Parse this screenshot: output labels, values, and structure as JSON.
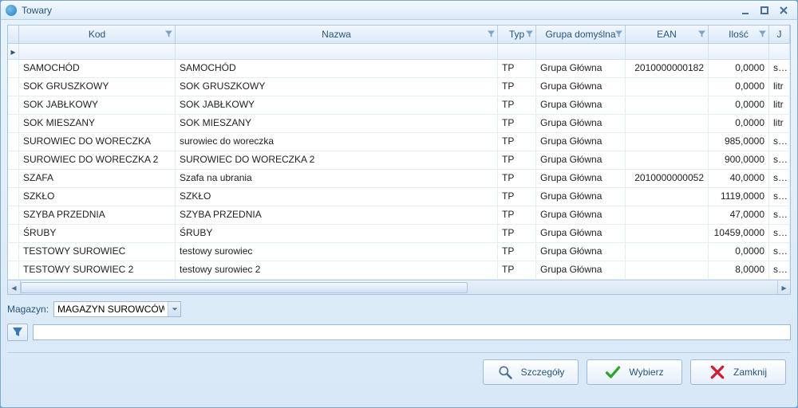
{
  "window": {
    "title": "Towary"
  },
  "columns": {
    "kod": "Kod",
    "nazwa": "Nazwa",
    "typ": "Typ",
    "grupa": "Grupa domyślna",
    "ean": "EAN",
    "ilosc": "Ilość",
    "jm": "J"
  },
  "rows": [
    {
      "kod": "SAMOCHÓD",
      "nazwa": "SAMOCHÓD",
      "typ": "TP",
      "grupa": "Grupa Główna",
      "ean": "2010000000182",
      "ilosc": "0,0000",
      "jm": "szt"
    },
    {
      "kod": "SOK GRUSZKOWY",
      "nazwa": "SOK GRUSZKOWY",
      "typ": "TP",
      "grupa": "Grupa Główna",
      "ean": "",
      "ilosc": "0,0000",
      "jm": "litr"
    },
    {
      "kod": "SOK JABŁKOWY",
      "nazwa": "SOK JABŁKOWY",
      "typ": "TP",
      "grupa": "Grupa Główna",
      "ean": "",
      "ilosc": "0,0000",
      "jm": "litr"
    },
    {
      "kod": "SOK MIESZANY",
      "nazwa": "SOK MIESZANY",
      "typ": "TP",
      "grupa": "Grupa Główna",
      "ean": "",
      "ilosc": "0,0000",
      "jm": "litr"
    },
    {
      "kod": "SUROWIEC DO WORECZKA",
      "nazwa": "surowiec do woreczka",
      "typ": "TP",
      "grupa": "Grupa Główna",
      "ean": "",
      "ilosc": "985,0000",
      "jm": "szt"
    },
    {
      "kod": "SUROWIEC DO WORECZKA 2",
      "nazwa": "SUROWIEC DO WORECZKA 2",
      "typ": "TP",
      "grupa": "Grupa Główna",
      "ean": "",
      "ilosc": "900,0000",
      "jm": "szt"
    },
    {
      "kod": "SZAFA",
      "nazwa": "Szafa na ubrania",
      "typ": "TP",
      "grupa": "Grupa Główna",
      "ean": "2010000000052",
      "ilosc": "40,0000",
      "jm": "szt"
    },
    {
      "kod": "SZKŁO",
      "nazwa": "SZKŁO",
      "typ": "TP",
      "grupa": "Grupa Główna",
      "ean": "",
      "ilosc": "1119,0000",
      "jm": "szt"
    },
    {
      "kod": "SZYBA PRZEDNIA",
      "nazwa": "SZYBA PRZEDNIA",
      "typ": "TP",
      "grupa": "Grupa Główna",
      "ean": "",
      "ilosc": "47,0000",
      "jm": "szt"
    },
    {
      "kod": "ŚRUBY",
      "nazwa": "ŚRUBY",
      "typ": "TP",
      "grupa": "Grupa Główna",
      "ean": "",
      "ilosc": "10459,0000",
      "jm": "szt"
    },
    {
      "kod": "TESTOWY SUROWIEC",
      "nazwa": "testowy surowiec",
      "typ": "TP",
      "grupa": "Grupa Główna",
      "ean": "",
      "ilosc": "0,0000",
      "jm": "szt"
    },
    {
      "kod": "TESTOWY SUROWIEC 2",
      "nazwa": "testowy surowiec 2",
      "typ": "TP",
      "grupa": "Grupa Główna",
      "ean": "",
      "ilosc": "8,0000",
      "jm": "szt"
    }
  ],
  "form": {
    "magazyn_label": "Magazyn:",
    "magazyn_value": "MAGAZYN SUROWCÓW"
  },
  "buttons": {
    "details": "Szczegóły",
    "select": "Wybierz",
    "close": "Zamknij"
  }
}
